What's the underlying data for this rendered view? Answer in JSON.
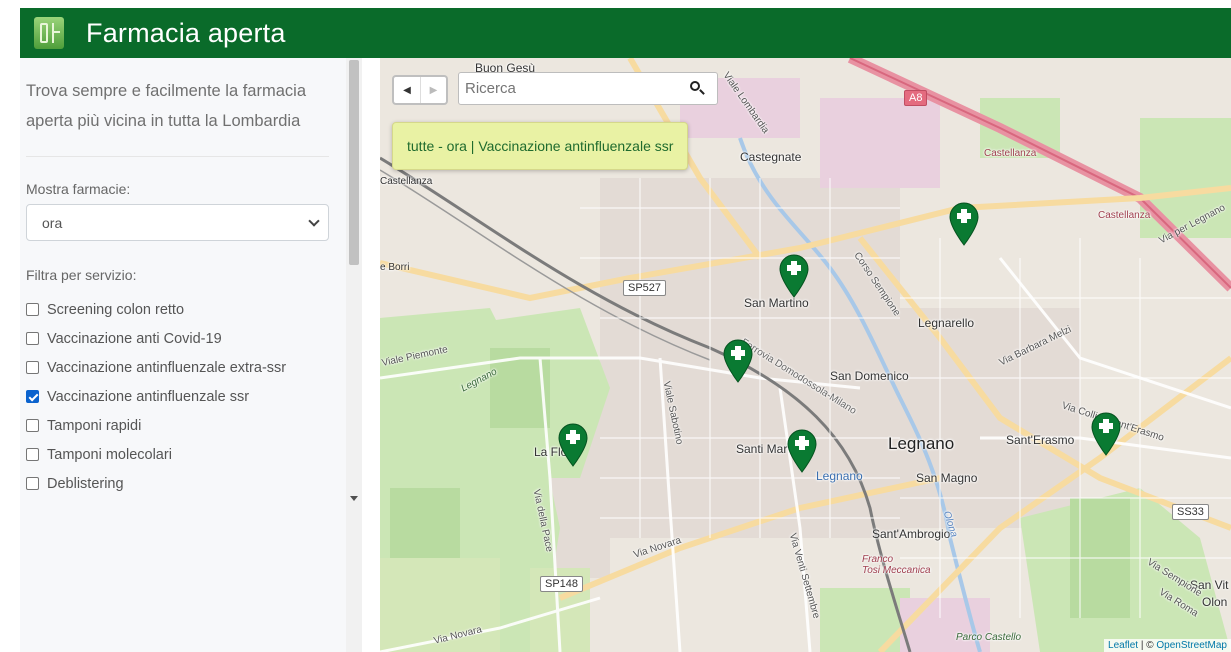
{
  "header": {
    "title": "Farmacia aperta"
  },
  "sidebar": {
    "intro": "Trova sempre e facilmente la farmacia aperta più vicina in tutta la Lombardia",
    "show_label": "Mostra farmacie:",
    "show_selected": "ora",
    "filter_label": "Filtra per servizio:",
    "services": [
      {
        "label": "Screening colon retto",
        "checked": false
      },
      {
        "label": "Vaccinazione anti Covid-19",
        "checked": false
      },
      {
        "label": "Vaccinazione antinfluenzale extra-ssr",
        "checked": false
      },
      {
        "label": "Vaccinazione antinfluenzale ssr",
        "checked": true
      },
      {
        "label": "Tamponi rapidi",
        "checked": false
      },
      {
        "label": "Tamponi molecolari",
        "checked": false
      },
      {
        "label": "Deblistering",
        "checked": false
      }
    ]
  },
  "map": {
    "search_placeholder": "Ricerca",
    "filter_tag": "tutte - ora | Vaccinazione antinfluenzale ssr",
    "attribution_leaflet": "Leaflet",
    "attribution_sep": " | © ",
    "attribution_osm": "OpenStreetMap",
    "places": {
      "buon_gesu": "Buon Gesù",
      "castegnate": "Castegnate",
      "castellanza_left": "Castellanza",
      "castellanza_top": "Castellanza",
      "castellanza_right": "Castellanza",
      "san_martino": "San Martino",
      "legnarello": "Legnarello",
      "san_domenico": "San Domenico",
      "legnano": "Legnano",
      "sant_erasmo": "Sant'Erasmo",
      "san_magno": "San Magno",
      "santi_martiri": "Santi Mar",
      "legnano_station": "Legnano",
      "la_flora": "La Flo",
      "sant_ambrogio": "Sant'Ambrogio",
      "franco_tosi": "Franco\nTosi Meccanica",
      "parco_castello": "Parco Castello",
      "san_vittore": "San Vit",
      "olona": "Olon",
      "borri": "e Borri"
    },
    "roads": {
      "viale_lombardia": "Viale Lombardia",
      "viale_piemonte": "Viale Piemonte",
      "viale_sabotino": "Viale Sabotino",
      "via_della_pace": "Via della Pace",
      "via_novara_1": "Via Novara",
      "via_novara_2": "Via Novara",
      "via_venti_settembre": "Via Venti Settembre",
      "corso_sempione": "Corso Sempione",
      "via_barbara_melzi": "Via Barbara Melzi",
      "via_colli_di_sant_erasmo": "Via Colli di Sant'Erasmo",
      "via_per_legnano": "Via per Legnano",
      "ferrovia": "Ferrovia Domodossola-Milano",
      "via_sempione": "Via Sempione",
      "via_roma": "Via Roma",
      "olona_river": "Olona",
      "legnano_park": "Legnano"
    },
    "shields": {
      "a8": "A8",
      "sp527": "SP527",
      "sp148": "SP148",
      "ss33": "SS33"
    }
  }
}
